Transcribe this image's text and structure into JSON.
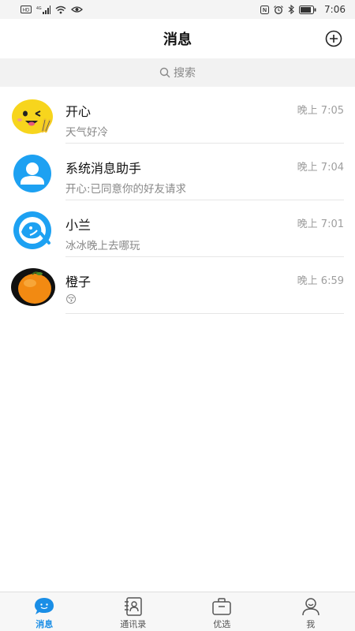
{
  "status_bar": {
    "time": "7:06",
    "left_icons": [
      "hd-icon",
      "signal-icon",
      "wifi-icon",
      "eye-icon"
    ],
    "right_icons": [
      "nfc-icon",
      "alarm-icon",
      "bluetooth-icon",
      "battery-icon"
    ]
  },
  "header": {
    "title": "消息",
    "add_icon": "plus-circle-icon"
  },
  "search": {
    "placeholder": "搜索",
    "icon": "search-icon"
  },
  "conversations": [
    {
      "name": "开心",
      "preview": "天气好冷",
      "time": "晚上 7:05",
      "avatar": "emoji-face-avatar"
    },
    {
      "name": "系统消息助手",
      "preview": "开心:已同意你的好友请求",
      "time": "晚上 7:04",
      "avatar": "person-avatar"
    },
    {
      "name": "小兰",
      "preview": "冰冰晚上去哪玩",
      "time": "晚上 7:01",
      "avatar": "bird-avatar"
    },
    {
      "name": "橙子",
      "preview": "😚",
      "time": "晚上 6:59",
      "avatar": "orange-avatar"
    }
  ],
  "tabs": [
    {
      "label": "消息",
      "icon": "chat-bubble-icon",
      "active": true
    },
    {
      "label": "通讯录",
      "icon": "contacts-icon",
      "active": false
    },
    {
      "label": "优选",
      "icon": "briefcase-icon",
      "active": false
    },
    {
      "label": "我",
      "icon": "profile-icon",
      "active": false
    }
  ],
  "colors": {
    "accent": "#1a8ee6",
    "avatar_blue": "#1da1f2",
    "emoji_yellow": "#f7d51d",
    "orange": "#f28a12"
  }
}
